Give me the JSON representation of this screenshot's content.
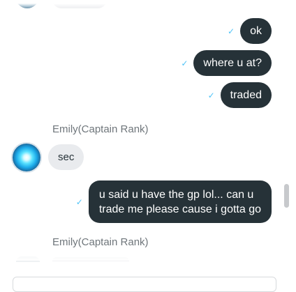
{
  "messages": [
    {
      "direction": "out",
      "text": "ok",
      "status": "sent"
    },
    {
      "direction": "out",
      "text": "where u at?",
      "status": "sent"
    },
    {
      "direction": "out",
      "text": "traded",
      "status": "sent"
    },
    {
      "direction": "in",
      "sender": "Emily(Captain Rank)",
      "text": "sec"
    },
    {
      "direction": "out",
      "text_lines": [
        "u said u have the gp lol... can u",
        "trade me please cause i gotta go"
      ],
      "status": "sent"
    },
    {
      "direction": "in",
      "sender": "Emily(Captain Rank)",
      "text": ""
    }
  ],
  "icons": {
    "sent_status": "check-icon"
  },
  "colors": {
    "outgoing_bubble": "#263238",
    "incoming_bubble": "#e9ebee",
    "sent_tick": "#4fc3f7",
    "sender_text": "#6f767b"
  }
}
